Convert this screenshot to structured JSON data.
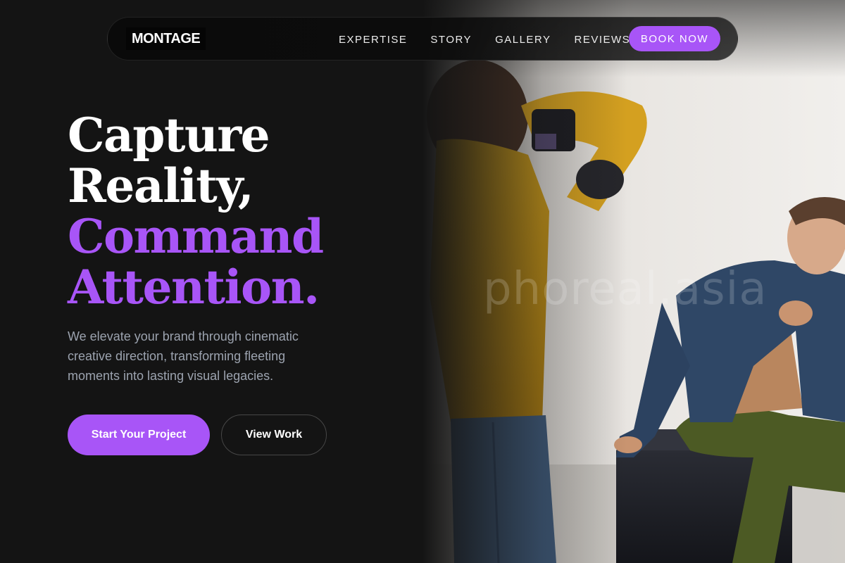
{
  "header": {
    "brand": "MONTAGE",
    "nav": [
      {
        "label": "EXPERTISE"
      },
      {
        "label": "STORY"
      },
      {
        "label": "GALLERY"
      },
      {
        "label": "REVIEWS"
      }
    ],
    "cta": "BOOK NOW"
  },
  "hero": {
    "title_line1": "Capture",
    "title_line2": "Reality,",
    "title_line3": "Command",
    "title_line4": "Attention.",
    "subtitle": "We elevate your brand through cinematic creative direction, transforming fleeting moments into lasting visual legacies.",
    "primary_button": "Start Your Project",
    "secondary_button": "View Work"
  },
  "image": {
    "watermark": "phoreal.asia"
  },
  "colors": {
    "accent": "#a855f7",
    "background": "#141414",
    "text_primary": "#ffffff",
    "text_muted": "#9ca3af"
  }
}
